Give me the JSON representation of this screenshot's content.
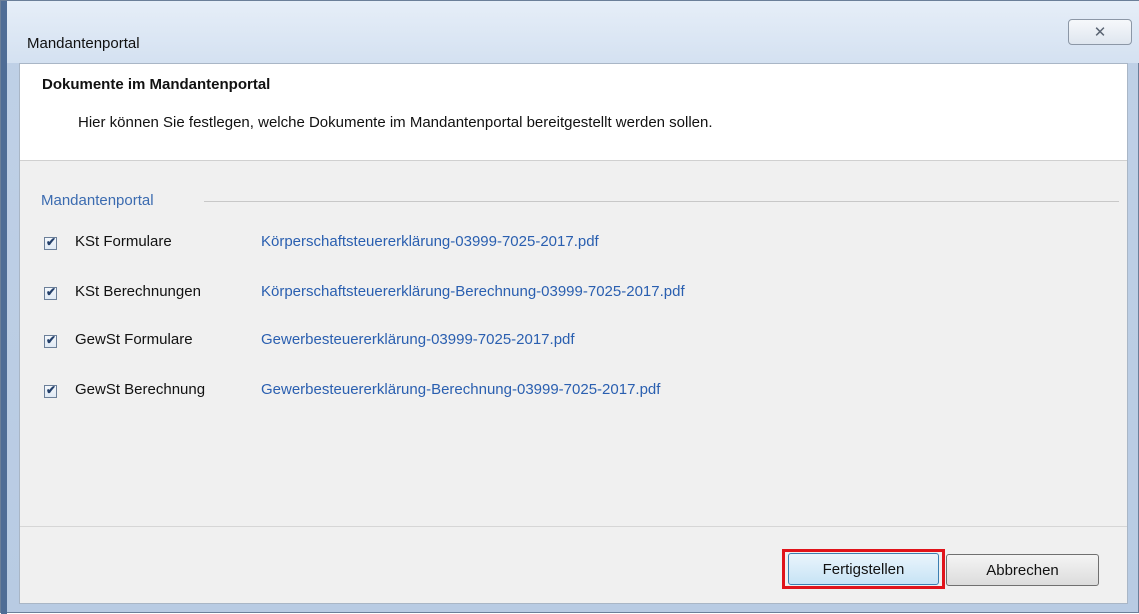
{
  "window": {
    "title": "Mandantenportal",
    "close_icon": "close-icon",
    "close_glyph": "✕"
  },
  "header": {
    "title": "Dokumente im Mandantenportal",
    "description": "Hier können Sie festlegen, welche Dokumente im Mandantenportal bereitgestellt werden sollen."
  },
  "group": {
    "label": "Mandantenportal",
    "items": [
      {
        "label": "KSt Formulare",
        "checked": true,
        "file": "Körperschaftsteuererklärung-03999-7025-2017.pdf"
      },
      {
        "label": "KSt Berechnungen",
        "checked": true,
        "file": "Körperschaftsteuererklärung-Berechnung-03999-7025-2017.pdf"
      },
      {
        "label": "GewSt Formulare",
        "checked": true,
        "file": "Gewerbesteuererklärung-03999-7025-2017.pdf"
      },
      {
        "label": "GewSt Berechnung",
        "checked": true,
        "file": "Gewerbesteuererklärung-Berechnung-03999-7025-2017.pdf"
      }
    ]
  },
  "footer": {
    "finish_label": "Fertigstellen",
    "cancel_label": "Abbrechen"
  },
  "check_glyph": "✔",
  "colors": {
    "link": "#2a5fb0",
    "group_label": "#3b6bb0",
    "highlight": "#e0141b"
  }
}
